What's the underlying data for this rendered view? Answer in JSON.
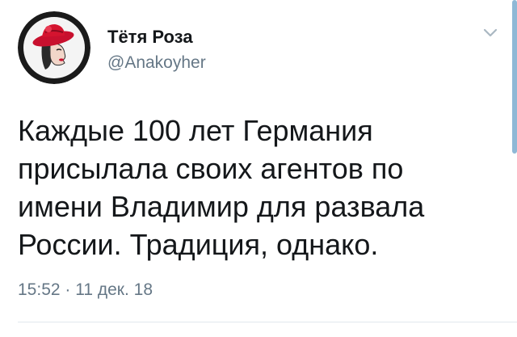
{
  "tweet": {
    "author": {
      "display_name": "Тётя Роза",
      "handle": "@Anakoyher",
      "avatar_icon": "woman-in-red-hat-avatar"
    },
    "menu_icon": "chevron-down-icon",
    "text_lines": [
      "Каждые 100 лет Германия",
      "присылала своих агентов по",
      "имени Владимир для развала",
      "России. Традиция, однако."
    ],
    "timestamp": "15:52 · 11 дек. 18"
  },
  "colors": {
    "text_primary": "#14171a",
    "text_secondary": "#657786",
    "avatar_hat": "#c8102e",
    "divider": "#e1e8ed"
  }
}
